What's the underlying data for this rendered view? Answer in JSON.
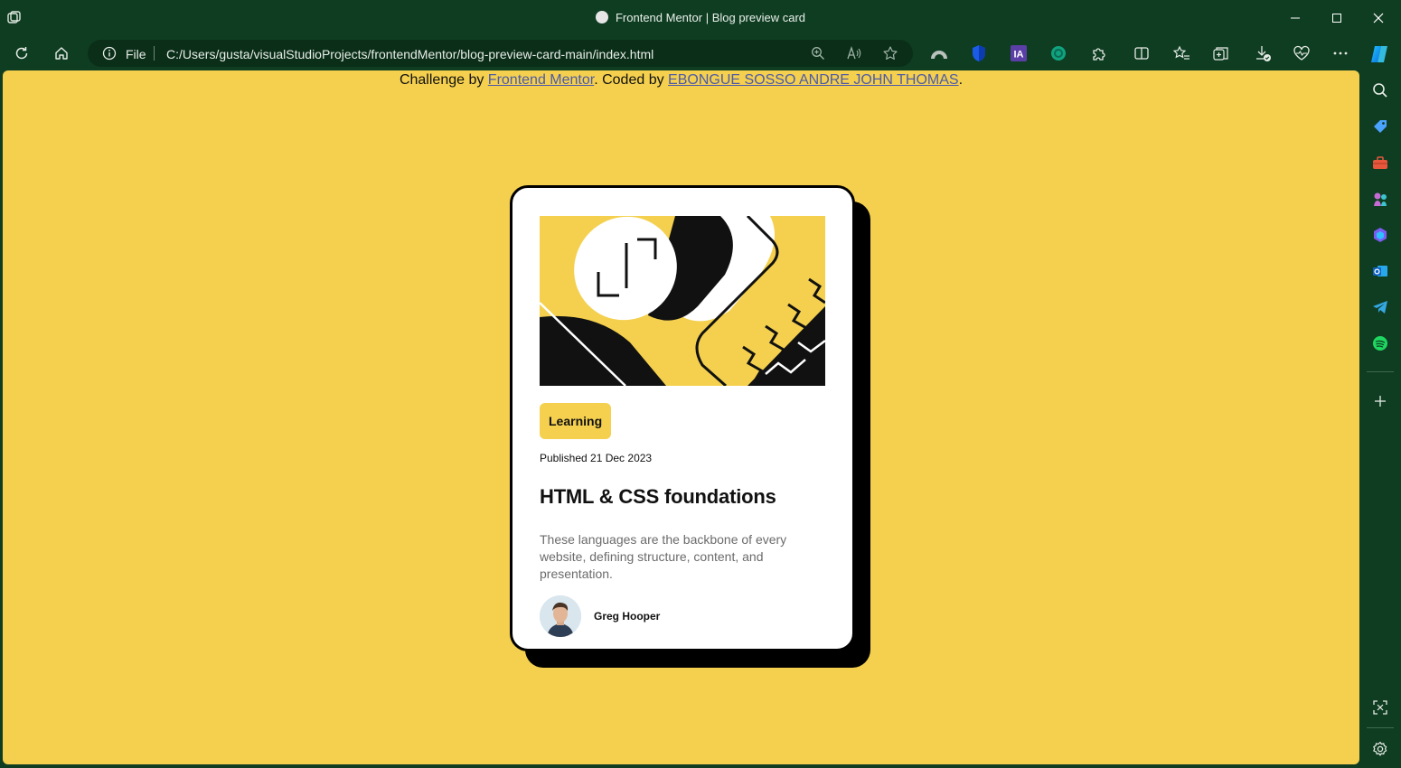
{
  "window": {
    "title": "Frontend Mentor | Blog preview card"
  },
  "address_bar": {
    "scheme_label": "File",
    "url": "C:/Users/gusta/visualStudioProjects/frontendMentor/blog-preview-card-main/index.html"
  },
  "page": {
    "attribution": {
      "prefix": "Challenge by ",
      "link1": "Frontend Mentor",
      "middle": ". Coded by ",
      "link2": "EBONGUE SOSSO ANDRE JOHN THOMAS",
      "suffix": "."
    },
    "card": {
      "tag": "Learning",
      "published": "Published 21 Dec 2023",
      "title": "HTML & CSS foundations",
      "description": "These languages are the backbone of every website, defining structure, content, and presentation.",
      "author": "Greg Hooper"
    }
  },
  "colors": {
    "page_bg": "#f4d04e",
    "browser_chrome": "#0f3d22",
    "link": "#4d5aa8"
  },
  "icons": {
    "toolbar": [
      "refresh-icon",
      "home-icon",
      "info-icon",
      "zoom-icon",
      "read-aloud-icon",
      "favorite-star-icon"
    ],
    "extensions": [
      "arc-extension-icon",
      "shield-extension-icon",
      "ia-extension-icon",
      "chatgpt-extension-icon",
      "puzzle-extensions-icon",
      "split-screen-icon",
      "favorites-icon",
      "collections-icon",
      "downloads-icon",
      "performance-icon",
      "more-icon",
      "copilot-icon"
    ],
    "sidebar": [
      "search-icon",
      "tag-icon",
      "tools-icon",
      "games-icon",
      "m365-icon",
      "outlook-icon",
      "telegram-icon",
      "spotify-icon",
      "add-icon",
      "screenshot-icon",
      "settings-icon"
    ]
  }
}
